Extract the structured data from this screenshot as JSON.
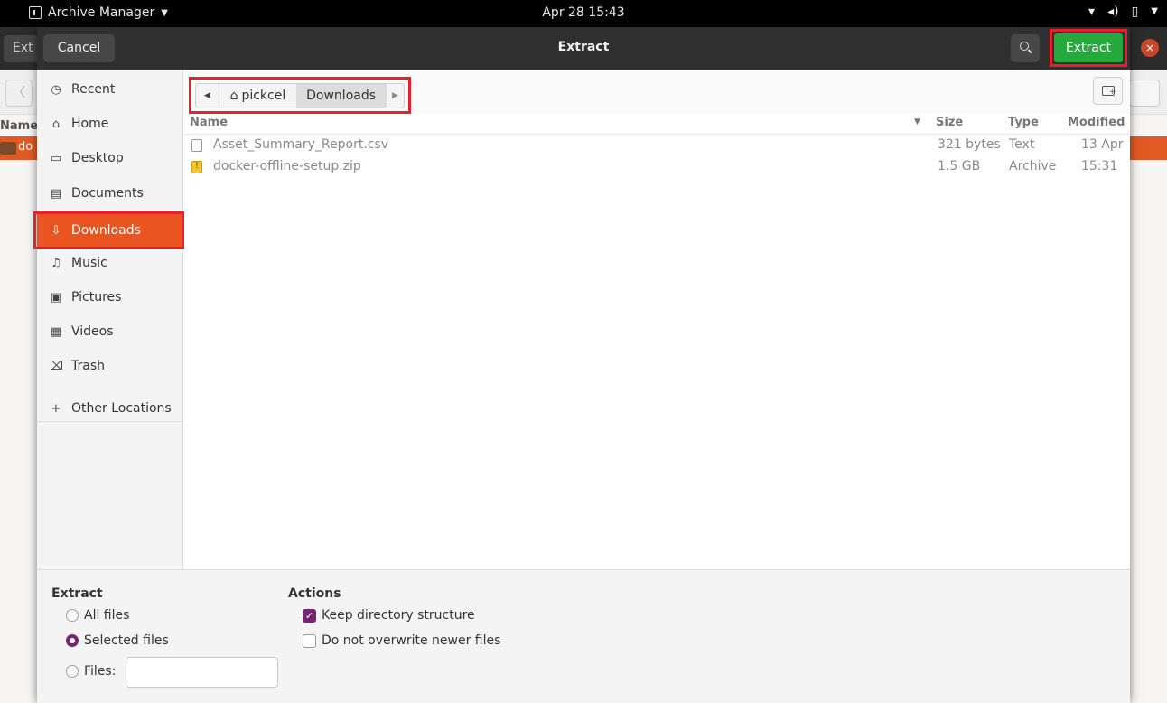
{
  "topbar": {
    "app_name": "Archive Manager",
    "clock": "Apr 28  15:43"
  },
  "background": {
    "ext_button": "Ext",
    "name_col": "Name",
    "row_text": "do"
  },
  "dialog": {
    "title": "Extract",
    "cancel_label": "Cancel",
    "extract_label": "Extract"
  },
  "sidebar": {
    "items": [
      {
        "label": "Recent",
        "icon": "clock-icon"
      },
      {
        "label": "Home",
        "icon": "home-icon"
      },
      {
        "label": "Desktop",
        "icon": "desktop-icon"
      },
      {
        "label": "Documents",
        "icon": "documents-icon"
      },
      {
        "label": "Downloads",
        "icon": "download-icon"
      },
      {
        "label": "Music",
        "icon": "music-icon"
      },
      {
        "label": "Pictures",
        "icon": "pictures-icon"
      },
      {
        "label": "Videos",
        "icon": "videos-icon"
      },
      {
        "label": "Trash",
        "icon": "trash-icon"
      }
    ],
    "other_locations": "Other Locations",
    "active": "Downloads",
    "accent": "#e95420"
  },
  "pathbar": {
    "home": "pickcel",
    "current": "Downloads"
  },
  "filelist": {
    "columns": {
      "name": "Name",
      "size": "Size",
      "type": "Type",
      "modified": "Modified"
    },
    "rows": [
      {
        "name": "Asset_Summary_Report.csv",
        "size": "321 bytes",
        "type": "Text",
        "modified": "13 Apr",
        "icon": "text-file-icon"
      },
      {
        "name": "docker-offline-setup.zip",
        "size": "1.5 GB",
        "type": "Archive",
        "modified": "15:31",
        "icon": "archive-file-icon"
      }
    ]
  },
  "options": {
    "extract_title": "Extract",
    "all_files": "All files",
    "selected_files": "Selected files",
    "files": "Files:",
    "files_value": "",
    "actions_title": "Actions",
    "keep_structure": "Keep directory structure",
    "no_overwrite": "Do not overwrite newer files"
  }
}
